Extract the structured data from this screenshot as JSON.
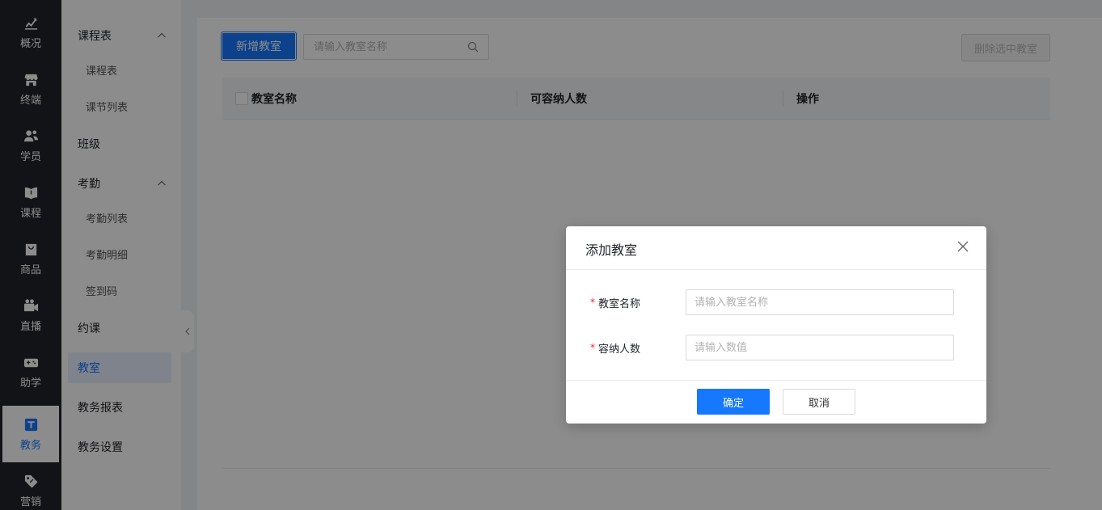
{
  "nav": {
    "items": [
      {
        "label": "概况",
        "icon": "chart-trend-icon"
      },
      {
        "label": "终端",
        "icon": "store-icon"
      },
      {
        "label": "学员",
        "icon": "users-icon"
      },
      {
        "label": "课程",
        "icon": "book-icon"
      },
      {
        "label": "商品",
        "icon": "bag-icon"
      },
      {
        "label": "直播",
        "icon": "video-camera-icon"
      },
      {
        "label": "助学",
        "icon": "gamepad-icon"
      },
      {
        "label": "教务",
        "icon": "edu-affairs-icon",
        "active": true
      },
      {
        "label": "营销",
        "icon": "tag-icon"
      }
    ]
  },
  "submenu": {
    "schedule_group": "课程表",
    "schedule_items": [
      "课程表",
      "课节列表"
    ],
    "class": "班级",
    "attendance_group": "考勤",
    "attendance_items": [
      "考勤列表",
      "考勤明细",
      "签到码"
    ],
    "booking": "约课",
    "classroom": "教室",
    "reports": "教务报表",
    "settings": "教务设置"
  },
  "toolbar": {
    "add_label": "新增教室",
    "search_placeholder": "请输入教室名称",
    "delete_label": "删除选中教室"
  },
  "table": {
    "columns": [
      "教室名称",
      "可容纳人数",
      "操作"
    ]
  },
  "dialog": {
    "title": "添加教室",
    "fields": [
      {
        "label": "教室名称",
        "placeholder": "请输入教室名称",
        "required_mark": "*"
      },
      {
        "label": "容纳人数",
        "placeholder": "请输入数值",
        "required_mark": "*"
      }
    ],
    "ok_label": "确定",
    "cancel_label": "取消"
  },
  "colors": {
    "primary": "#1677ff",
    "nav_bg": "#1f2329",
    "required": "#f5222d"
  }
}
